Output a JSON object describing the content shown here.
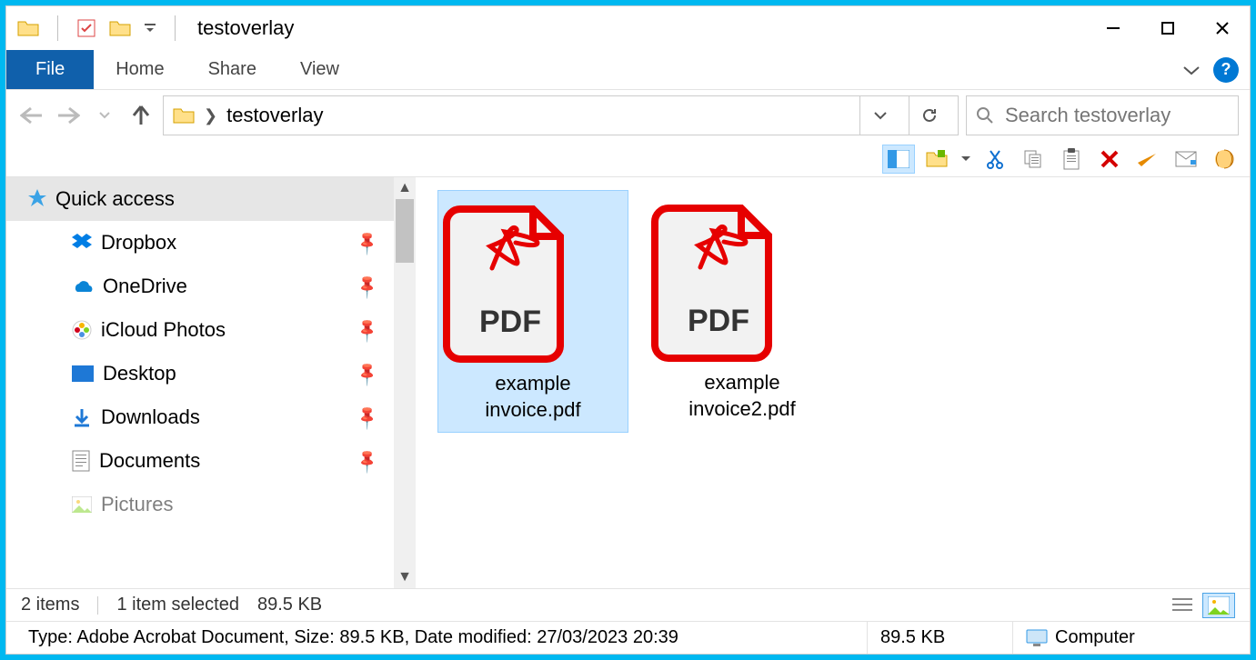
{
  "title": "testoverlay",
  "tabs": {
    "file": "File",
    "home": "Home",
    "share": "Share",
    "view": "View"
  },
  "breadcrumb": "testoverlay",
  "search": {
    "placeholder": "Search testoverlay"
  },
  "sidebar": {
    "header": "Quick access",
    "items": [
      {
        "label": "Dropbox"
      },
      {
        "label": "OneDrive"
      },
      {
        "label": "iCloud Photos"
      },
      {
        "label": "Desktop"
      },
      {
        "label": "Downloads"
      },
      {
        "label": "Documents"
      },
      {
        "label": "Pictures"
      }
    ]
  },
  "files": [
    {
      "name": "example\ninvoice.pdf",
      "selected": true
    },
    {
      "name": "example\ninvoice2.pdf",
      "selected": false
    }
  ],
  "status": {
    "count": "2 items",
    "selected": "1 item selected",
    "size_short": "89.5 KB",
    "details": "Type: Adobe Acrobat Document, Size: 89.5 KB, Date modified: 27/03/2023 20:39",
    "size": "89.5 KB",
    "location": "Computer"
  }
}
